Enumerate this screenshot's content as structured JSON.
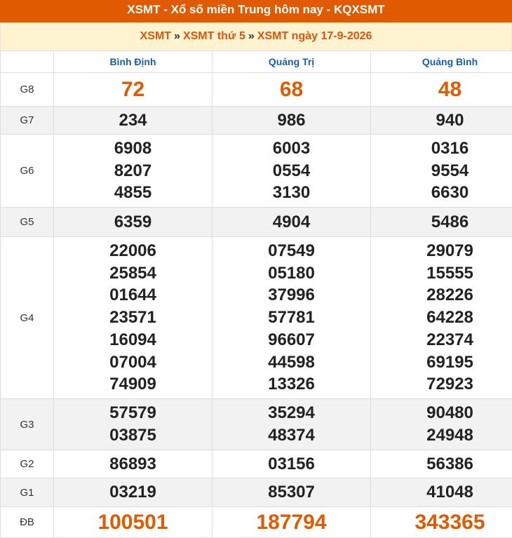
{
  "header": {
    "title": "XSMT - Xổ số miền Trung hôm nay - KQXSMT"
  },
  "breadcrumb": {
    "items": [
      "XSMT",
      "XSMT thứ 5",
      "XSMT ngày 17-9-2026"
    ],
    "separator": "»"
  },
  "table": {
    "provinces": [
      "Bình Định",
      "Quảng Trị",
      "Quảng Bình"
    ],
    "rows": [
      {
        "label": "G8",
        "values": [
          [
            "72"
          ],
          [
            "68"
          ],
          [
            "48"
          ]
        ]
      },
      {
        "label": "G7",
        "values": [
          [
            "234"
          ],
          [
            "986"
          ],
          [
            "940"
          ]
        ]
      },
      {
        "label": "G6",
        "values": [
          [
            "6908",
            "8207",
            "4855"
          ],
          [
            "6003",
            "0554",
            "3130"
          ],
          [
            "0316",
            "9554",
            "6630"
          ]
        ]
      },
      {
        "label": "G5",
        "values": [
          [
            "6359"
          ],
          [
            "4904"
          ],
          [
            "5486"
          ]
        ]
      },
      {
        "label": "G4",
        "values": [
          [
            "22006",
            "25854",
            "01644",
            "23571",
            "16094",
            "07004",
            "74909"
          ],
          [
            "07549",
            "05180",
            "37996",
            "57781",
            "96607",
            "44598",
            "13326"
          ],
          [
            "29079",
            "15555",
            "28226",
            "64228",
            "22374",
            "69195",
            "72923"
          ]
        ]
      },
      {
        "label": "G3",
        "values": [
          [
            "57579",
            "03875"
          ],
          [
            "35294",
            "48374"
          ],
          [
            "90480",
            "24948"
          ]
        ]
      },
      {
        "label": "G2",
        "values": [
          [
            "86893"
          ],
          [
            "03156"
          ],
          [
            "56386"
          ]
        ]
      },
      {
        "label": "G1",
        "values": [
          [
            "03219"
          ],
          [
            "85307"
          ],
          [
            "41048"
          ]
        ]
      },
      {
        "label": "ĐB",
        "values": [
          [
            "100501"
          ],
          [
            "187794"
          ],
          [
            "343365"
          ]
        ]
      }
    ]
  },
  "colors": {
    "header_bg": "#e05a00",
    "breadcrumb_bg": "#fff4cf",
    "accent": "#e05a00",
    "province_text": "#1a5ea8",
    "alt_row": "#f2f2f2"
  }
}
